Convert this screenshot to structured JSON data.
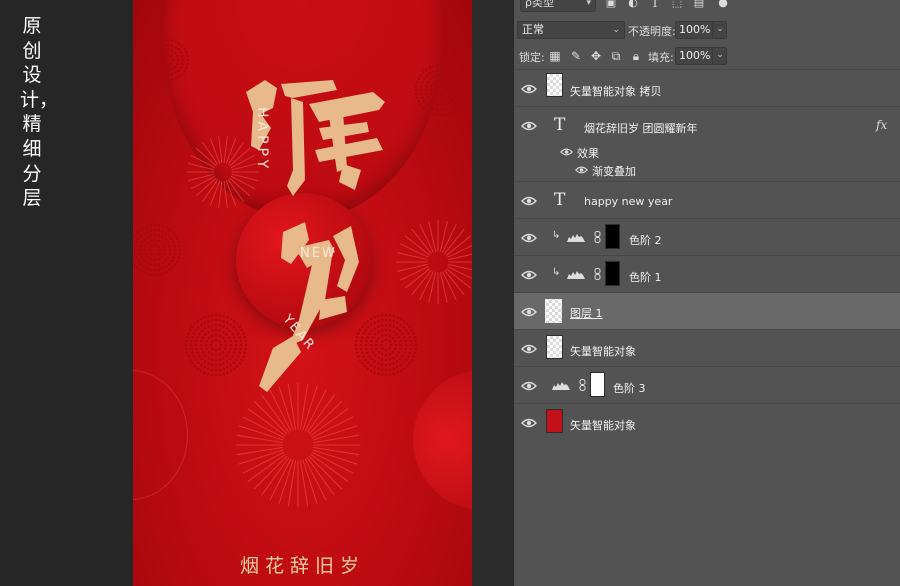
{
  "caption": {
    "text": "原创设计，精细分层"
  },
  "poster": {
    "calligraphy": "除夕",
    "vertical_happy": "HAPPY",
    "new_text": "NEW",
    "year_text": "YEAR",
    "tagline": "烟花辞旧岁"
  },
  "panel": {
    "filter": {
      "kind_label": "ρ类型"
    },
    "blend": {
      "mode": "正常",
      "opacity_label": "不透明度:",
      "opacity_value": "100%"
    },
    "lock": {
      "lock_label": "锁定:",
      "fill_label": "填充:",
      "fill_value": "100%"
    },
    "layers": [
      {
        "name": "矢量智能对象 拷贝",
        "kind": "smart"
      },
      {
        "name": "烟花辞旧岁 团圆耀新年",
        "kind": "text",
        "fx": "fx"
      },
      {
        "name": "效果",
        "kind": "effect-header"
      },
      {
        "name": "渐变叠加",
        "kind": "effect"
      },
      {
        "name": "happy new year",
        "kind": "text"
      },
      {
        "name": "色阶 2",
        "kind": "adjust-clipped"
      },
      {
        "name": "色阶 1",
        "kind": "adjust-clipped"
      },
      {
        "name": "图层 1",
        "kind": "pixel",
        "selected": true
      },
      {
        "name": "矢量智能对象",
        "kind": "smart"
      },
      {
        "name": "色阶 3",
        "kind": "adjust"
      },
      {
        "name": "矢量智能对象",
        "kind": "smart-red"
      }
    ]
  },
  "colors": {
    "poster_red": "#c20c12",
    "gold": "#f1cf9f",
    "panel_bg": "#535353",
    "selected_row": "#696969"
  }
}
